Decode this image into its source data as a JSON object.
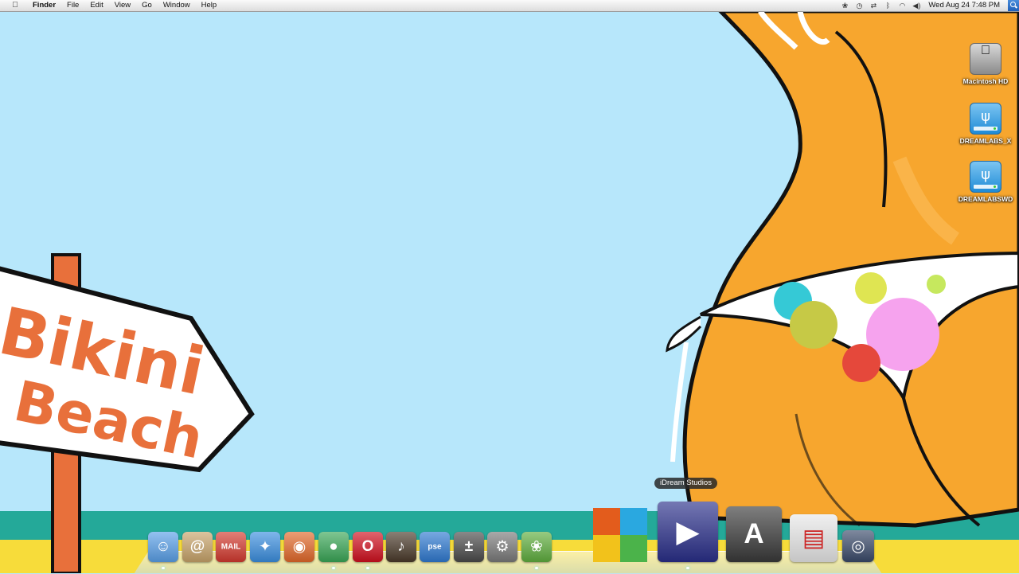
{
  "menubar": {
    "apple": "",
    "app_name": "Finder",
    "menus": [
      "File",
      "Edit",
      "View",
      "Go",
      "Window",
      "Help"
    ],
    "clock": "Wed Aug 24  7:48 PM",
    "status_icons": [
      "paw-icon",
      "time-machine-icon",
      "sync-icon",
      "bluetooth-icon",
      "wifi-icon",
      "volume-icon",
      "spotlight-icon"
    ]
  },
  "wallpaper": {
    "sign_line1": "Bikini",
    "sign_line2": "Beach"
  },
  "desktop_icons": [
    {
      "label": "Macintosh HD",
      "icon": "hard-drive-icon"
    },
    {
      "label": "DREAMLABS_X",
      "icon": "usb-drive-icon"
    },
    {
      "label": "DREAMLABSWD",
      "icon": "usb-drive-icon"
    }
  ],
  "dock": {
    "tooltip": "iDream Studios",
    "items": [
      {
        "name": "finder",
        "icon": "finder-icon",
        "glyph": "☺",
        "color": "#5aa0e8"
      },
      {
        "name": "address-book",
        "icon": "address-book-icon",
        "glyph": "@",
        "color": "#c8a46a"
      },
      {
        "name": "mail",
        "icon": "mail-icon",
        "glyph": "MAIL",
        "color": "#d43a2f"
      },
      {
        "name": "safari",
        "icon": "safari-icon",
        "glyph": "✦",
        "color": "#3b8fe0"
      },
      {
        "name": "firefox",
        "icon": "firefox-icon",
        "glyph": "◉",
        "color": "#e3692a"
      },
      {
        "name": "chrome",
        "icon": "chrome-icon",
        "glyph": "●",
        "color": "#3aa757"
      },
      {
        "name": "opera",
        "icon": "opera-icon",
        "glyph": "O",
        "color": "#d1101f"
      },
      {
        "name": "garageband",
        "icon": "garageband-icon",
        "glyph": "♪",
        "color": "#4a3a2a"
      },
      {
        "name": "photoshop-elements",
        "icon": "photoshop-elements-icon",
        "glyph": "pse",
        "color": "#2f7ad1"
      },
      {
        "name": "calculator",
        "icon": "calculator-icon",
        "glyph": "±",
        "color": "#4a4a4a"
      },
      {
        "name": "system-preferences",
        "icon": "system-preferences-icon",
        "glyph": "⚙",
        "color": "#7a7a7a"
      },
      {
        "name": "iphoto",
        "icon": "iphoto-icon",
        "glyph": "❀",
        "color": "#5fae3e"
      },
      {
        "name": "office",
        "icon": "office-icon",
        "glyph": "",
        "color": "#e35c1c"
      },
      {
        "name": "idream-studios",
        "icon": "idream-studios-icon",
        "glyph": "▶",
        "color": "#2a2f8a"
      },
      {
        "name": "app-store",
        "icon": "app-store-icon",
        "glyph": "A",
        "color": "#3a3a3a"
      },
      {
        "name": "preview",
        "icon": "preview-icon",
        "glyph": "▤",
        "color": "#e8e8e8"
      },
      {
        "name": "disk-utility",
        "icon": "disk-utility-icon",
        "glyph": "◎",
        "color": "#3a4a6a"
      }
    ]
  }
}
